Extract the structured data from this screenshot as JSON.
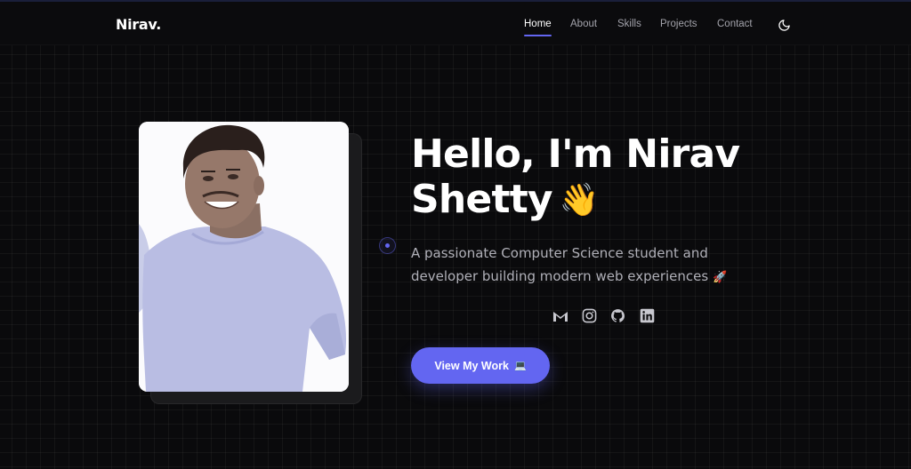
{
  "nav": {
    "logo": "Nirav.",
    "links": [
      {
        "label": "Home",
        "active": true
      },
      {
        "label": "About",
        "active": false
      },
      {
        "label": "Skills",
        "active": false
      },
      {
        "label": "Projects",
        "active": false
      },
      {
        "label": "Contact",
        "active": false
      }
    ],
    "theme_icon": "moon-icon"
  },
  "hero": {
    "title_line1": "Hello, I'm Nirav",
    "title_line2": "Shetty",
    "wave_emoji": "👋",
    "subtitle_line1": "A passionate Computer Science student and",
    "subtitle_line2": "developer building modern web experiences",
    "subtitle_emoji": "🚀",
    "socials": [
      "gmail-icon",
      "instagram-icon",
      "github-icon",
      "linkedin-icon"
    ],
    "cta_label": "View My Work",
    "cta_emoji": "💻"
  },
  "colors": {
    "accent": "#6366f1",
    "background": "#0a0a0c",
    "text_muted": "#b0b0b8"
  }
}
